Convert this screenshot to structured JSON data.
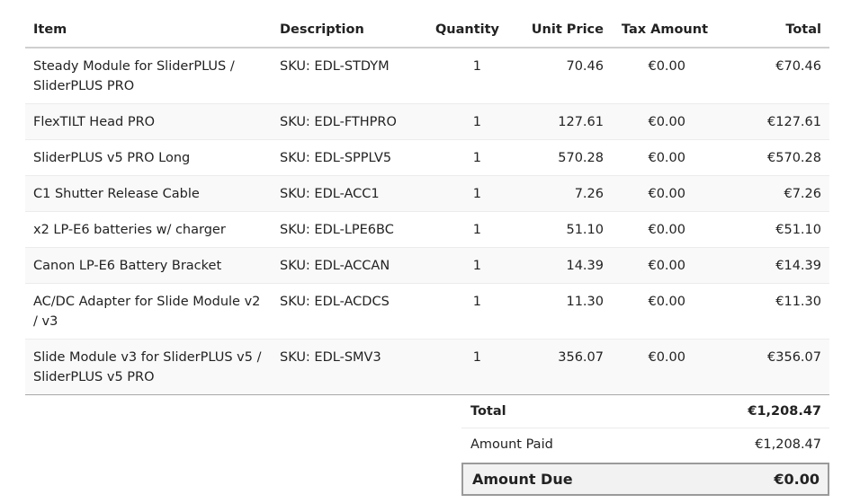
{
  "headers": {
    "item": "Item",
    "description": "Description",
    "quantity": "Quantity",
    "unit_price": "Unit Price",
    "tax_amount": "Tax Amount",
    "total": "Total"
  },
  "rows": [
    {
      "item": "Steady Module for SliderPLUS / SliderPLUS PRO",
      "description": "SKU: EDL-STDYM",
      "quantity": "1",
      "unit_price": "70.46",
      "tax_amount": "€0.00",
      "total": "€70.46"
    },
    {
      "item": "FlexTILT Head PRO",
      "description": "SKU: EDL-FTHPRO",
      "quantity": "1",
      "unit_price": "127.61",
      "tax_amount": "€0.00",
      "total": "€127.61"
    },
    {
      "item": "SliderPLUS v5 PRO Long",
      "description": "SKU: EDL-SPPLV5",
      "quantity": "1",
      "unit_price": "570.28",
      "tax_amount": "€0.00",
      "total": "€570.28"
    },
    {
      "item": "C1 Shutter Release Cable",
      "description": "SKU: EDL-ACC1",
      "quantity": "1",
      "unit_price": "7.26",
      "tax_amount": "€0.00",
      "total": "€7.26"
    },
    {
      "item": "x2 LP-E6 batteries w/ charger",
      "description": "SKU: EDL-LPE6BC",
      "quantity": "1",
      "unit_price": "51.10",
      "tax_amount": "€0.00",
      "total": "€51.10"
    },
    {
      "item": "Canon LP-E6 Battery Bracket",
      "description": "SKU: EDL-ACCAN",
      "quantity": "1",
      "unit_price": "14.39",
      "tax_amount": "€0.00",
      "total": "€14.39"
    },
    {
      "item": "AC/DC Adapter for Slide Module v2 / v3",
      "description": "SKU: EDL-ACDCS",
      "quantity": "1",
      "unit_price": "11.30",
      "tax_amount": "€0.00",
      "total": "€11.30"
    },
    {
      "item": "Slide Module v3 for SliderPLUS v5 / SliderPLUS v5 PRO",
      "description": "SKU: EDL-SMV3",
      "quantity": "1",
      "unit_price": "356.07",
      "tax_amount": "€0.00",
      "total": "€356.07"
    }
  ],
  "totals": {
    "total_label": "Total",
    "total_value": "€1,208.47",
    "paid_label": "Amount Paid",
    "paid_value": "€1,208.47",
    "due_label": "Amount Due",
    "due_value": "€0.00"
  }
}
